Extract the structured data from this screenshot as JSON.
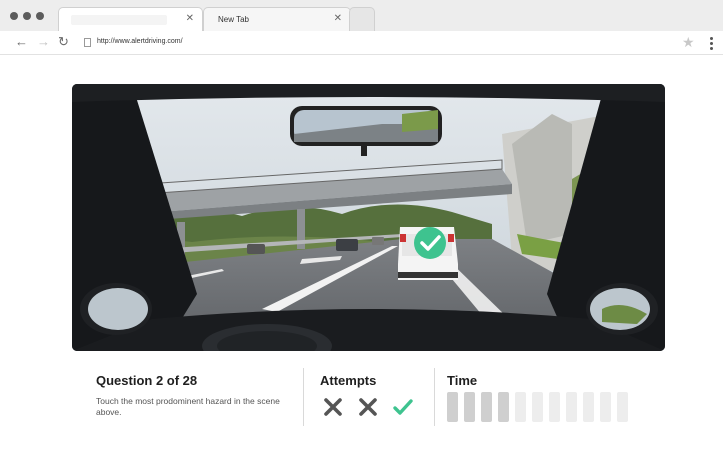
{
  "browser": {
    "tabs": [
      {
        "label": "",
        "active": true
      },
      {
        "label": "New Tab",
        "active": false
      }
    ],
    "url": "http://www.alertdriving.com/"
  },
  "question": {
    "title": "Question 2 of 28",
    "text": "Touch the most prodominent hazard in the scene above."
  },
  "attempts": {
    "title": "Attempts",
    "results": [
      "incorrect",
      "incorrect",
      "correct"
    ]
  },
  "time": {
    "title": "Time",
    "segments_total": 11,
    "segments_elapsed": 4
  },
  "hazard_marker": {
    "status": "correct",
    "icon": "check-circle-icon"
  },
  "colors": {
    "correct": "#3ec38f",
    "incorrect": "#555555",
    "timer_elapsed": "#cfcfcf",
    "timer_remaining": "#ededed"
  }
}
